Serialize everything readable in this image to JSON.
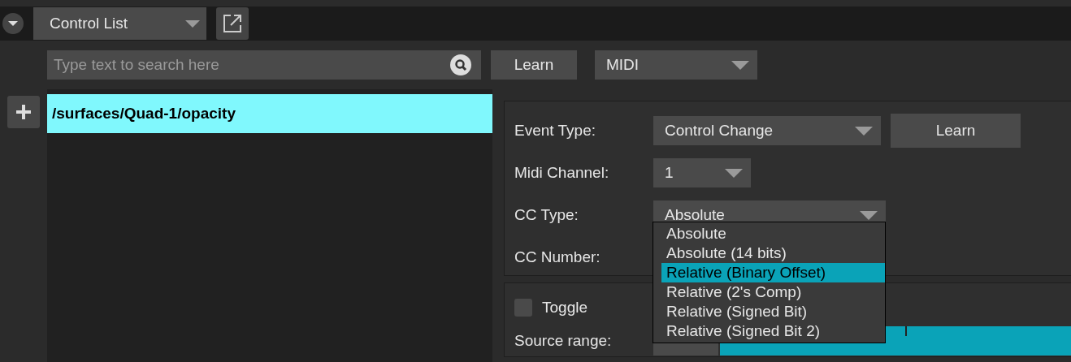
{
  "header": {
    "view_selector": "Control List"
  },
  "toolbar": {
    "search": {
      "placeholder": "Type text to search here"
    },
    "learn_button": "Learn",
    "protocol": "MIDI"
  },
  "control_list": [
    {
      "path": "/surfaces/Quad-1/opacity",
      "selected": true
    }
  ],
  "settings": {
    "event_type": {
      "label": "Event Type:",
      "value": "Control Change"
    },
    "learn_button": "Learn",
    "midi_channel": {
      "label": "Midi Channel:",
      "value": "1"
    },
    "cc_type": {
      "label": "CC Type:",
      "value": "Absolute",
      "expanded": true,
      "options": [
        {
          "label": "Absolute",
          "highlighted": false
        },
        {
          "label": "Absolute (14 bits)",
          "highlighted": false
        },
        {
          "label": "Relative (Binary Offset)",
          "highlighted": true
        },
        {
          "label": "Relative (2's Comp)",
          "highlighted": false
        },
        {
          "label": "Relative (Signed Bit)",
          "highlighted": false
        },
        {
          "label": "Relative (Signed Bit 2)",
          "highlighted": false
        }
      ]
    },
    "cc_number": {
      "label": "CC Number:"
    }
  },
  "mapping": {
    "toggle": {
      "label": "Toggle",
      "checked": false
    },
    "source_range": {
      "label": "Source range:"
    }
  }
}
